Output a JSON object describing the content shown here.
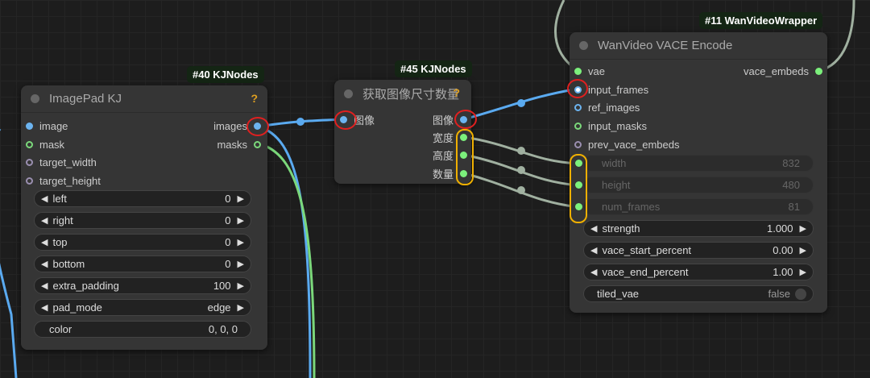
{
  "colors": {
    "image": "#6cb4f0",
    "mask": "#7bd87b",
    "int": "#7cf07c",
    "latent": "#9a8fb0",
    "wire_image": "#5aaaf0",
    "wire_int": "#a0b0a0"
  },
  "node40": {
    "badge": "#40 KJNodes",
    "title": "ImagePad KJ",
    "help": "?",
    "inputs": [
      "image",
      "mask",
      "target_width",
      "target_height"
    ],
    "outputs": [
      "images",
      "masks"
    ],
    "widgets": [
      {
        "label": "left",
        "value": "0"
      },
      {
        "label": "right",
        "value": "0"
      },
      {
        "label": "top",
        "value": "0"
      },
      {
        "label": "bottom",
        "value": "0"
      },
      {
        "label": "extra_padding",
        "value": "100"
      },
      {
        "label": "pad_mode",
        "value": "edge"
      },
      {
        "label": "color",
        "value": "0, 0, 0"
      }
    ]
  },
  "node45": {
    "badge": "#45 KJNodes",
    "title": "获取图像尺寸数量",
    "help": "?",
    "inputs": [
      "图像"
    ],
    "outputs": [
      "图像",
      "宽度",
      "高度",
      "数量"
    ]
  },
  "node11": {
    "badge": "#11 WanVideoWrapper",
    "title": "WanVideo VACE Encode",
    "inputs": [
      "vae",
      "input_frames",
      "ref_images",
      "input_masks",
      "prev_vace_embeds"
    ],
    "outputs": [
      "vace_embeds"
    ],
    "converted": [
      {
        "label": "width",
        "value": "832"
      },
      {
        "label": "height",
        "value": "480"
      },
      {
        "label": "num_frames",
        "value": "81"
      }
    ],
    "widgets": [
      {
        "label": "strength",
        "value": "1.000"
      },
      {
        "label": "vace_start_percent",
        "value": "0.00"
      },
      {
        "label": "vace_end_percent",
        "value": "1.00"
      }
    ],
    "toggle": {
      "label": "tiled_vae",
      "value": "false"
    }
  }
}
